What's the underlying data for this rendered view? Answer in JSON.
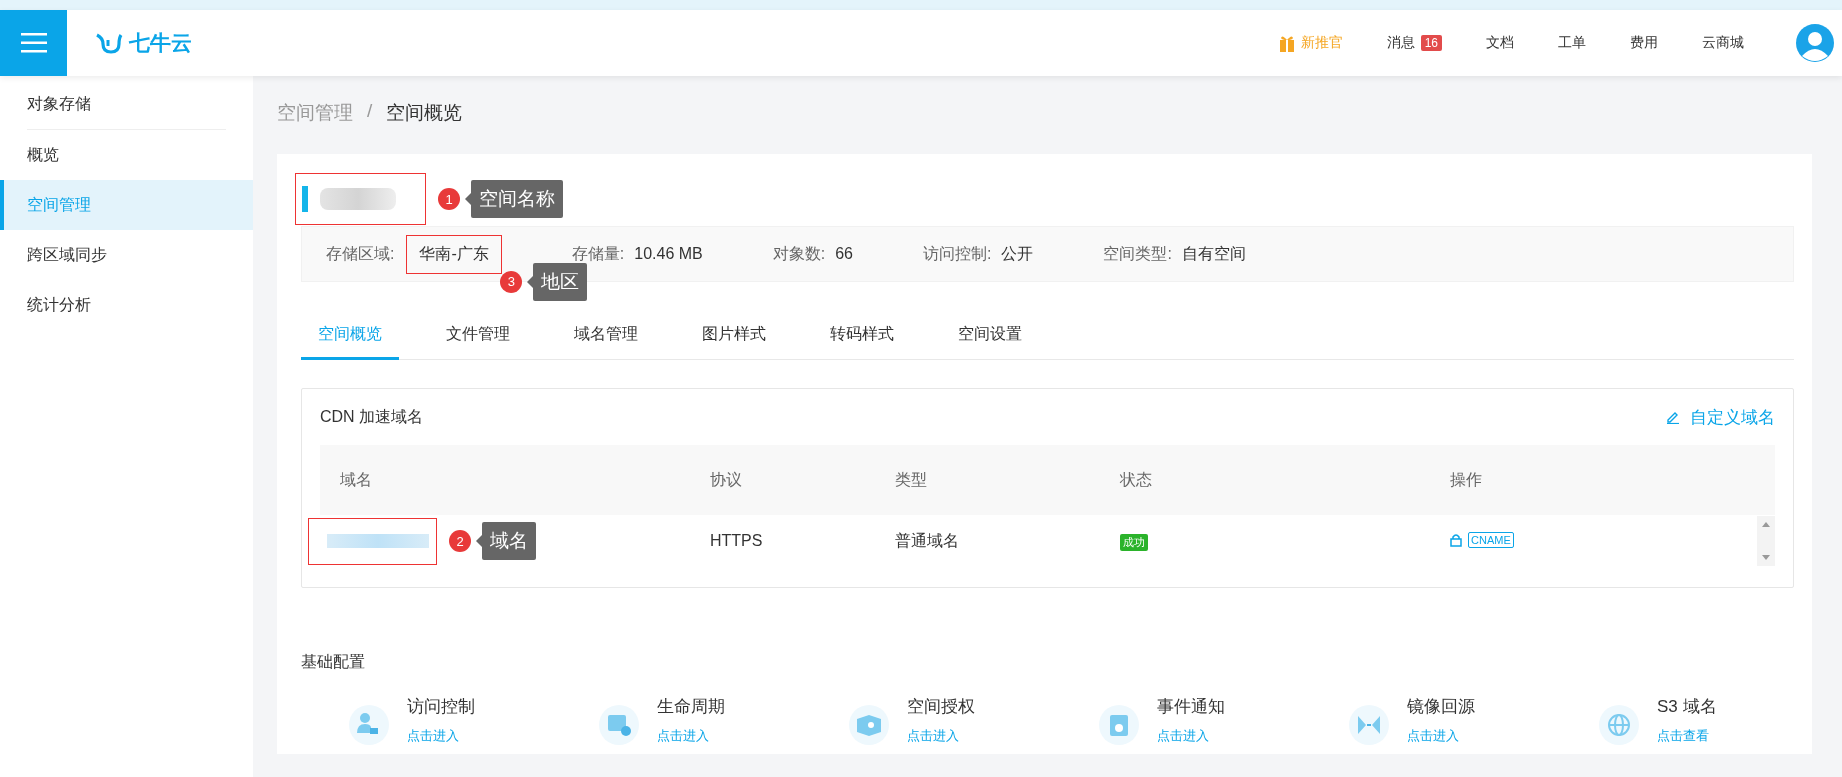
{
  "header": {
    "logo": "七牛云",
    "nav": [
      {
        "kind": "promo",
        "label": "新推官"
      },
      {
        "kind": "badge",
        "label": "消息",
        "badge": "16"
      },
      {
        "kind": "plain",
        "label": "文档"
      },
      {
        "kind": "plain",
        "label": "工单"
      },
      {
        "kind": "plain",
        "label": "费用"
      },
      {
        "kind": "plain",
        "label": "云商城"
      }
    ]
  },
  "sidebar": {
    "title": "对象存储",
    "items": [
      {
        "label": "概览",
        "selected": false
      },
      {
        "label": "空间管理",
        "selected": true
      },
      {
        "label": "跨区域同步",
        "selected": false
      },
      {
        "label": "统计分析",
        "selected": false
      }
    ]
  },
  "breadcrumb": [
    {
      "label": "空间管理",
      "current": false
    },
    {
      "label": "空间概览",
      "current": true
    }
  ],
  "separator": "/",
  "annotations": [
    {
      "number": "1",
      "label": "空间名称"
    },
    {
      "number": "3",
      "label": "地区"
    },
    {
      "number": "2",
      "label": "域名"
    }
  ],
  "info": [
    {
      "label": "存储区域:",
      "value": "华南-广东"
    },
    {
      "label": "存储量:",
      "value": "10.46 MB"
    },
    {
      "label": "对象数:",
      "value": "66"
    },
    {
      "label": "访问控制:",
      "value": "公开"
    },
    {
      "label": "空间类型:",
      "value": "自有空间"
    }
  ],
  "tabs": [
    {
      "label": "空间概览",
      "selected": true
    },
    {
      "label": "文件管理",
      "selected": false
    },
    {
      "label": "域名管理",
      "selected": false
    },
    {
      "label": "图片样式",
      "selected": false
    },
    {
      "label": "转码样式",
      "selected": false
    },
    {
      "label": "空间设置",
      "selected": false
    }
  ],
  "cdn": {
    "title": "CDN 加速域名",
    "action": "自定义域名",
    "columns": [
      "域名",
      "协议",
      "类型",
      "状态",
      "操作"
    ],
    "rows": [
      {
        "protocol": "HTTPS",
        "type": "普通域名",
        "status": "成功",
        "color": "#2bb32b",
        "op": "CNAME"
      }
    ]
  },
  "config": {
    "title": "基础配置",
    "items": [
      {
        "label": "访问控制",
        "link": "点击进入"
      },
      {
        "label": "生命周期",
        "link": "点击进入"
      },
      {
        "label": "空间授权",
        "link": "点击进入"
      },
      {
        "label": "事件通知",
        "link": "点击进入"
      },
      {
        "label": "镜像回源",
        "link": "点击进入"
      },
      {
        "label": "S3 域名",
        "link": "点击查看"
      }
    ]
  }
}
